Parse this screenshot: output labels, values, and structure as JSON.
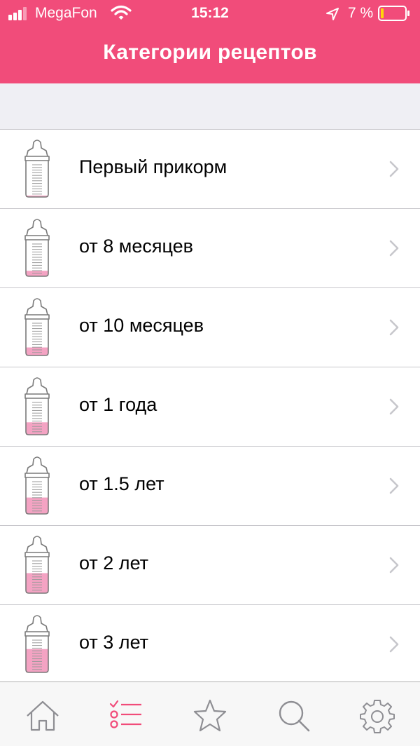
{
  "status_bar": {
    "carrier": "MegaFon",
    "time": "15:12",
    "battery_percent": "7 %"
  },
  "nav": {
    "title": "Категории рецептов"
  },
  "categories": [
    {
      "label": "Первый прикорм",
      "fill_level": 0.04
    },
    {
      "label": "от 8 месяцев",
      "fill_level": 0.15
    },
    {
      "label": "от 10 месяцев",
      "fill_level": 0.22
    },
    {
      "label": "от 1 года",
      "fill_level": 0.34
    },
    {
      "label": "от 1.5 лет",
      "fill_level": 0.45
    },
    {
      "label": "от 2 лет",
      "fill_level": 0.55
    },
    {
      "label": "от 3 лет",
      "fill_level": 0.64
    }
  ],
  "tabbar": {
    "items": [
      {
        "icon": "home-icon",
        "active": false
      },
      {
        "icon": "checklist-icon",
        "active": true
      },
      {
        "icon": "star-icon",
        "active": false
      },
      {
        "icon": "search-icon",
        "active": false
      },
      {
        "icon": "gear-icon",
        "active": false
      }
    ]
  },
  "colors": {
    "accent": "#f14c7a",
    "bottle_fill": "#f4a3c3",
    "inactive_icon": "#8e8e93"
  }
}
